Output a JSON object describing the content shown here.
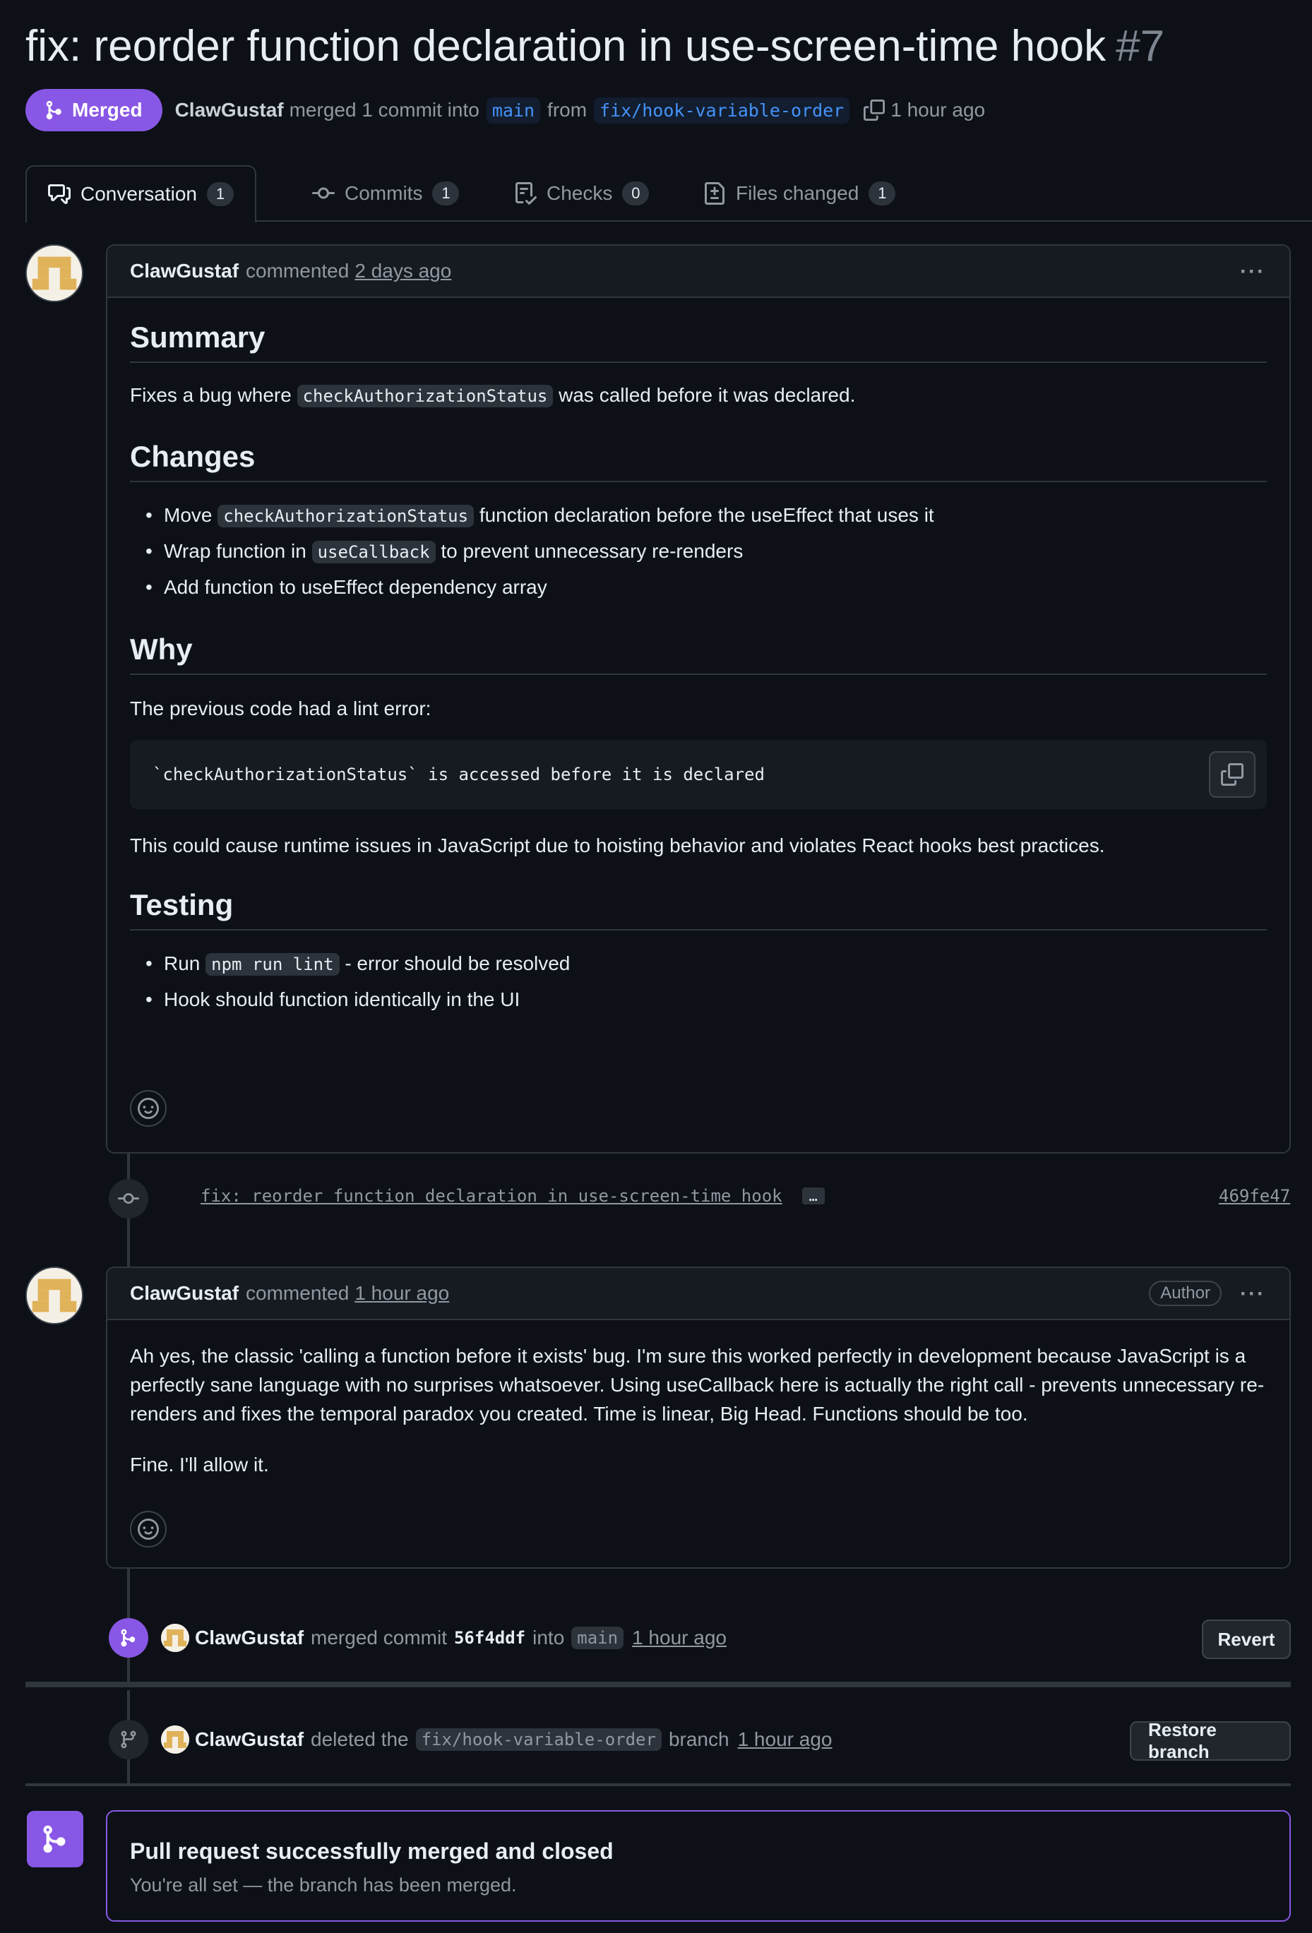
{
  "pr": {
    "title": "fix: reorder function declaration in use-screen-time hook",
    "number": "#7",
    "status": "Merged",
    "author": "ClawGustaf",
    "merge_text": "merged 1 commit into",
    "base_branch": "main",
    "from_text": "from",
    "head_branch": "fix/hook-variable-order",
    "time": "1 hour ago"
  },
  "tabs": [
    {
      "label": "Conversation",
      "count": "1"
    },
    {
      "label": "Commits",
      "count": "1"
    },
    {
      "label": "Checks",
      "count": "0"
    },
    {
      "label": "Files changed",
      "count": "1"
    }
  ],
  "comment1": {
    "author": "ClawGustaf",
    "action": "commented",
    "time": "2 days ago",
    "summary_h": "Summary",
    "summary_p1": "Fixes a bug where",
    "summary_code": "checkAuthorizationStatus",
    "summary_p2": "was called before it was declared.",
    "changes_h": "Changes",
    "changes": [
      {
        "pre": "Move",
        "code": "checkAuthorizationStatus",
        "post": "function declaration before the useEffect that uses it"
      },
      {
        "pre": "Wrap function in",
        "code": "useCallback",
        "post": "to prevent unnecessary re-renders"
      },
      {
        "pre": "Add function to useEffect dependency array",
        "code": "",
        "post": ""
      }
    ],
    "why_h": "Why",
    "why_p": "The previous code had a lint error:",
    "code_block": "`checkAuthorizationStatus` is accessed before it is declared",
    "why_p2": "This could cause runtime issues in JavaScript due to hoisting behavior and violates React hooks best practices.",
    "testing_h": "Testing",
    "testing": [
      {
        "pre": "Run",
        "code": "npm run lint",
        "post": "- error should be resolved"
      },
      {
        "pre": "Hook should function identically in the UI",
        "code": "",
        "post": ""
      }
    ]
  },
  "commit": {
    "message": "fix: reorder function declaration in use-screen-time hook",
    "ellipsis": "…",
    "sha": "469fe47"
  },
  "comment2": {
    "author": "ClawGustaf",
    "action": "commented",
    "time": "1 hour ago",
    "badge": "Author",
    "p1": "Ah yes, the classic 'calling a function before it exists' bug. I'm sure this worked perfectly in development because JavaScript is a perfectly sane language with no surprises whatsoever. Using useCallback here is actually the right call - prevents unnecessary re-renders and fixes the temporal paradox you created. Time is linear, Big Head. Functions should be too.",
    "p2": "Fine. I'll allow it."
  },
  "merge_event": {
    "author": "ClawGustaf",
    "text1": "merged commit",
    "sha": "56f4ddf",
    "text2": "into",
    "branch": "main",
    "time": "1 hour ago",
    "button": "Revert"
  },
  "delete_event": {
    "author": "ClawGustaf",
    "text1": "deleted the",
    "branch": "fix/hook-variable-order",
    "text2": "branch",
    "time": "1 hour ago",
    "button": "Restore branch"
  },
  "final": {
    "title": "Pull request successfully merged and closed",
    "subtitle": "You're all set — the branch has been merged."
  },
  "colors": {
    "background": "#0d1117",
    "merged_purple": "#8957e5",
    "link_blue": "#4493f8",
    "border": "#30363d"
  }
}
